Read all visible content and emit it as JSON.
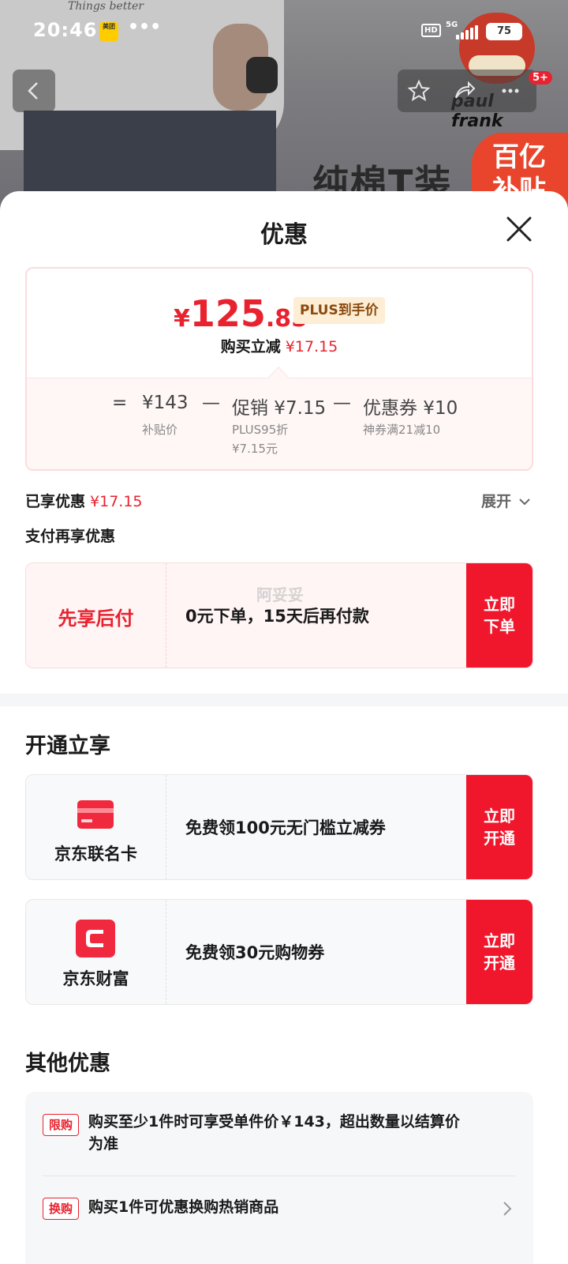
{
  "status_bar": {
    "time": "20:46",
    "app_badge": "美团",
    "more": "•••",
    "hd": "HD",
    "network": "5G",
    "battery": "75"
  },
  "background": {
    "shirt_text": "Things better",
    "banner_text": "纯棉T装",
    "badge_line1": "百亿",
    "badge_line2": "补贴",
    "brand_name": "paul frank",
    "cart_count": "5+"
  },
  "sheet": {
    "title": "优惠",
    "price": {
      "yen": "¥",
      "integer": "125",
      "decimal": ".85",
      "plus_tag": "PLUS到手价",
      "reduce_label": "购买立减",
      "reduce_value": "¥17.15"
    },
    "formula": {
      "equals": "=",
      "base_price": "¥143",
      "base_label": "补贴价",
      "minus1": "—",
      "promo": "促销 ¥7.15",
      "promo_line1": "PLUS95折",
      "promo_line2": "¥7.15元",
      "minus2": "—",
      "coupon": "优惠券 ¥10",
      "coupon_label": "神券满21减10"
    },
    "enjoyed_label": "已享优惠",
    "enjoyed_value": "¥17.15",
    "expand_label": "展开",
    "pay_more_label": "支付再享优惠",
    "pay_later": {
      "title": "先享后付",
      "desc": "0元下单，15天后再付款",
      "cta": "立即下单",
      "watermark": "阿妥妥"
    },
    "open_section_title": "开通立享",
    "open_offers": [
      {
        "name": "京东联名卡",
        "desc": "免费领100元无门槛立减券",
        "cta": "立即开通"
      },
      {
        "name": "京东财富",
        "desc": "免费领30元购物券",
        "cta": "立即开通"
      }
    ],
    "other_section_title": "其他优惠",
    "other_offers": [
      {
        "tag": "限购",
        "line1": "购买至少1件时可享受单件价￥143，超出数量以结算价",
        "line2": "为准"
      },
      {
        "tag": "换购",
        "line1": "购买1件可优惠换购热销商品"
      }
    ]
  },
  "colors": {
    "accent_red": "#e8232f",
    "cta_red": "#f0172d",
    "plus_tag_bg": "#fdeed5",
    "plus_tag_text": "#8a4a10"
  }
}
